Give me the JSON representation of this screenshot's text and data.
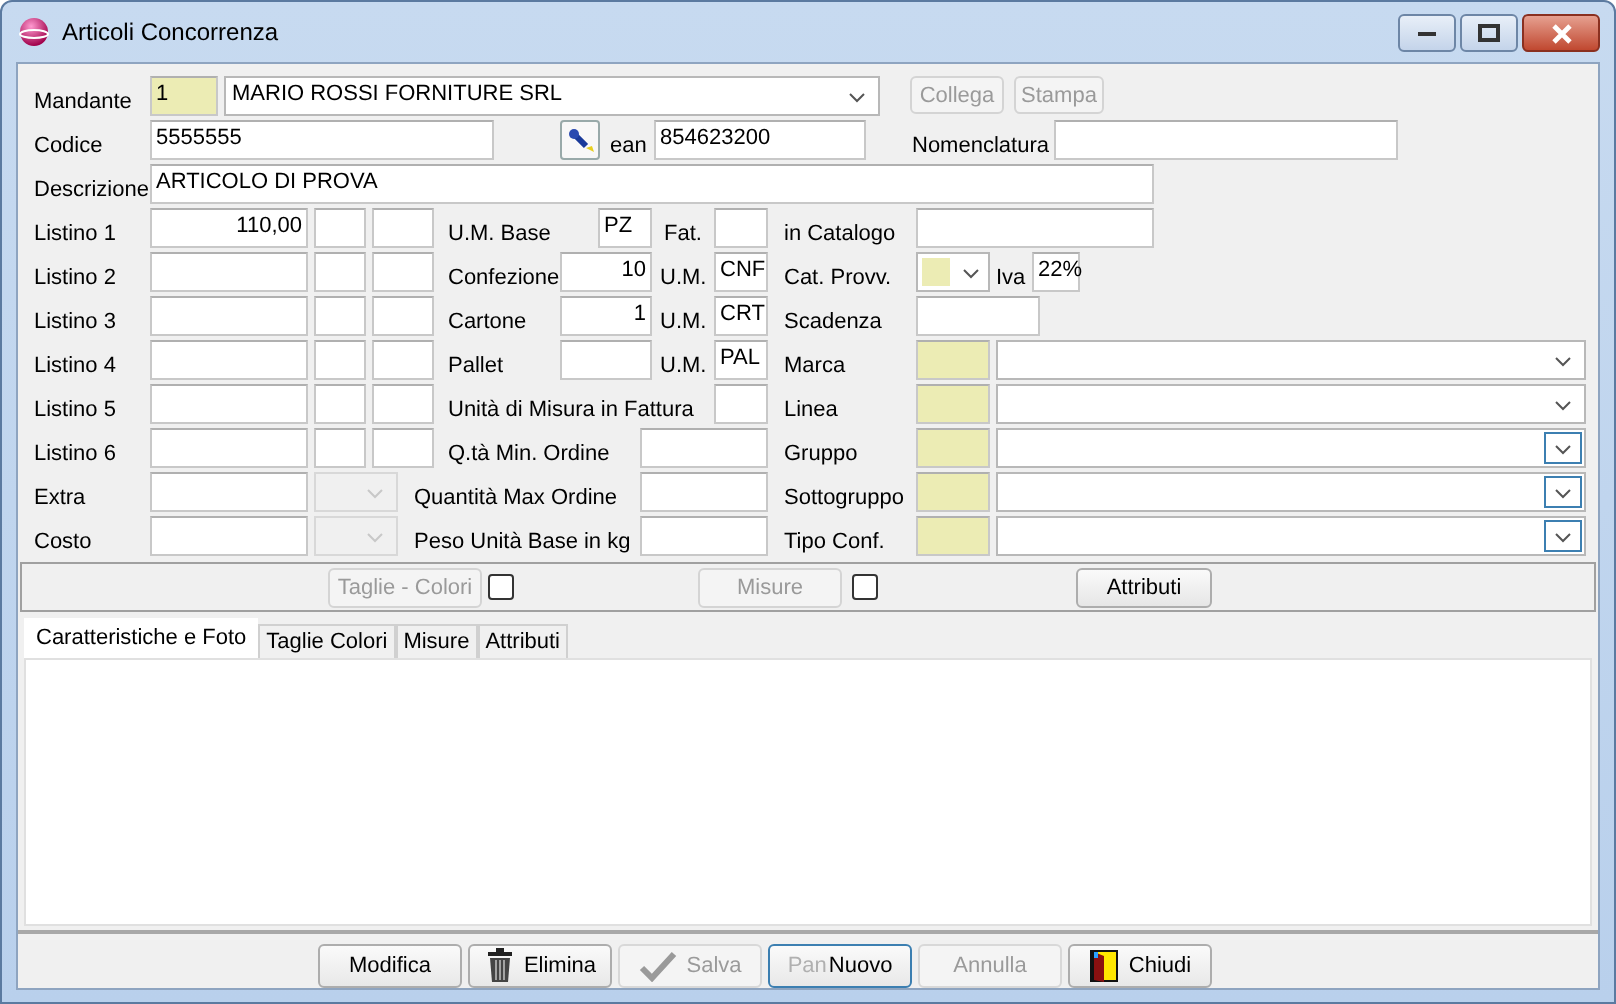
{
  "window": {
    "title": "Articoli Concorrenza"
  },
  "rows": [
    {
      "items": [
        {
          "kind": "label",
          "text": "Mandante"
        },
        {
          "kind": "code-field",
          "value": "1"
        },
        {
          "kind": "combo",
          "value": "MARIO ROSSI FORNITURE SRL",
          "highlighted": false,
          "disabled": false
        },
        {
          "kind": "button",
          "text": "Collega",
          "disabled": true
        },
        {
          "kind": "button",
          "text": "Stampa",
          "disabled": true
        }
      ]
    },
    {
      "items": [
        {
          "kind": "label",
          "text": "Codice"
        },
        {
          "kind": "field",
          "value": "5555555"
        },
        {
          "kind": "icon"
        },
        {
          "kind": "label",
          "text": "ean"
        },
        {
          "kind": "field",
          "value": "854623200"
        },
        {
          "kind": "label",
          "text": "Nomenclatura"
        },
        {
          "kind": "field"
        }
      ]
    },
    {
      "items": [
        {
          "kind": "label",
          "text": "Descrizione"
        },
        {
          "kind": "field",
          "value": "ARTICOLO DI PROVA"
        }
      ]
    },
    {
      "items": [
        {
          "kind": "label",
          "text": "Listino 1"
        },
        {
          "kind": "number-field",
          "value": "110,00"
        },
        {
          "kind": "field"
        },
        {
          "kind": "field"
        },
        {
          "kind": "label",
          "text": "U.M. Base"
        },
        {
          "kind": "field",
          "value": "PZ"
        },
        {
          "kind": "label",
          "text": "Fat."
        },
        {
          "kind": "field"
        },
        {
          "kind": "label",
          "text": "in Catalogo"
        },
        {
          "kind": "field"
        }
      ]
    },
    {
      "items": [
        {
          "kind": "label",
          "text": "Listino 2"
        },
        {
          "kind": "field"
        },
        {
          "kind": "field"
        },
        {
          "kind": "field"
        },
        {
          "kind": "label",
          "text": "Confezione"
        },
        {
          "kind": "number-field",
          "value": "10"
        },
        {
          "kind": "label",
          "text": "U.M."
        },
        {
          "kind": "field",
          "value": "CNF"
        },
        {
          "kind": "label",
          "text": "Cat. Provv."
        },
        {
          "kind": "code-combo",
          "highlighted": false,
          "disabled": false
        },
        {
          "kind": "label",
          "text": "Iva"
        },
        {
          "kind": "field",
          "value": "22%"
        }
      ]
    },
    {
      "items": [
        {
          "kind": "label",
          "text": "Listino 3"
        },
        {
          "kind": "field"
        },
        {
          "kind": "field"
        },
        {
          "kind": "field"
        },
        {
          "kind": "label",
          "text": "Cartone"
        },
        {
          "kind": "number-field",
          "value": "1"
        },
        {
          "kind": "label",
          "text": "U.M."
        },
        {
          "kind": "field",
          "value": "CRT"
        },
        {
          "kind": "label",
          "text": "Scadenza"
        },
        {
          "kind": "field"
        }
      ]
    },
    {
      "items": [
        {
          "kind": "label",
          "text": "Listino 4"
        },
        {
          "kind": "field"
        },
        {
          "kind": "field"
        },
        {
          "kind": "field"
        },
        {
          "kind": "label",
          "text": "Pallet"
        },
        {
          "kind": "field"
        },
        {
          "kind": "label",
          "text": "U.M."
        },
        {
          "kind": "field",
          "value": "PAL"
        },
        {
          "kind": "label",
          "text": "Marca"
        },
        {
          "kind": "code-field"
        },
        {
          "kind": "combo",
          "highlighted": false,
          "disabled": false
        }
      ]
    },
    {
      "items": [
        {
          "kind": "label",
          "text": "Listino 5"
        },
        {
          "kind": "field"
        },
        {
          "kind": "field"
        },
        {
          "kind": "field"
        },
        {
          "kind": "label",
          "text": "Unità di Misura in Fattura"
        },
        {
          "kind": "field"
        },
        {
          "kind": "label",
          "text": "Linea"
        },
        {
          "kind": "code-field"
        },
        {
          "kind": "combo",
          "highlighted": false,
          "disabled": false
        }
      ]
    },
    {
      "items": [
        {
          "kind": "label",
          "text": "Listino 6"
        },
        {
          "kind": "field"
        },
        {
          "kind": "field"
        },
        {
          "kind": "field"
        },
        {
          "kind": "label",
          "text": "Q.tà Min. Ordine"
        },
        {
          "kind": "field"
        },
        {
          "kind": "label",
          "text": "Gruppo"
        },
        {
          "kind": "code-field"
        },
        {
          "kind": "combo",
          "highlighted": true,
          "disabled": false
        }
      ]
    },
    {
      "items": [
        {
          "kind": "label",
          "text": "Extra"
        },
        {
          "kind": "field"
        },
        {
          "kind": "combo",
          "highlighted": false,
          "disabled": true
        },
        {
          "kind": "label",
          "text": "Quantità Max Ordine"
        },
        {
          "kind": "field"
        },
        {
          "kind": "label",
          "text": "Sottogruppo"
        },
        {
          "kind": "code-field"
        },
        {
          "kind": "combo",
          "highlighted": true,
          "disabled": false
        }
      ]
    },
    {
      "items": [
        {
          "kind": "label",
          "text": "Costo"
        },
        {
          "kind": "field"
        },
        {
          "kind": "combo",
          "highlighted": false,
          "disabled": true
        },
        {
          "kind": "label",
          "text": "Peso Unità Base in kg"
        },
        {
          "kind": "field"
        },
        {
          "kind": "label",
          "text": "Tipo Conf."
        },
        {
          "kind": "code-field"
        },
        {
          "kind": "combo",
          "highlighted": true,
          "disabled": false
        }
      ]
    }
  ],
  "options_bar": [
    {
      "kind": "button",
      "text": "Taglie - Colori",
      "disabled": true
    },
    {
      "kind": "checkbox",
      "checked": false
    },
    {
      "kind": "button",
      "text": "Misure",
      "disabled": true
    },
    {
      "kind": "checkbox",
      "checked": false
    },
    {
      "kind": "button",
      "text": "Attributi",
      "disabled": false
    }
  ],
  "tabs": [
    {
      "label": "Caratteristiche e Foto",
      "selected": true
    },
    {
      "label": "Taglie Colori",
      "selected": false
    },
    {
      "label": "Misure",
      "selected": false
    },
    {
      "label": "Attributi",
      "selected": false
    }
  ],
  "buttons": [
    {
      "kind": "plain",
      "label": "Modifica",
      "disabled": false,
      "focused": false
    },
    {
      "kind": "delete",
      "label": "Elimina",
      "disabled": false,
      "focused": false
    },
    {
      "kind": "save",
      "label": "Salva",
      "disabled": true,
      "focused": false
    },
    {
      "kind": "plain",
      "label": "Nuovo",
      "overlay_text": "Pan",
      "disabled": false,
      "focused": true
    },
    {
      "kind": "plain",
      "label": "Annulla",
      "disabled": true,
      "focused": false
    },
    {
      "kind": "close",
      "label": "Chiudi",
      "disabled": false,
      "focused": false
    }
  ]
}
